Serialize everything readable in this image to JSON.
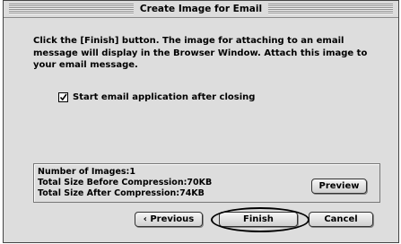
{
  "window": {
    "title": "Create Image for Email"
  },
  "message": "Click the [Finish] button. The image for attaching to an email message will display in the Browser Window. Attach this image to your email message.",
  "checkbox": {
    "label": "Start email application after closing",
    "checked": true
  },
  "info": {
    "number_of_images": "Number of Images:1",
    "size_before": "Total Size Before Compression:70KB",
    "size_after": "Total Size After Compression:74KB"
  },
  "buttons": {
    "preview": "Preview",
    "previous": "‹ Previous",
    "finish": "Finish",
    "cancel": "Cancel"
  }
}
